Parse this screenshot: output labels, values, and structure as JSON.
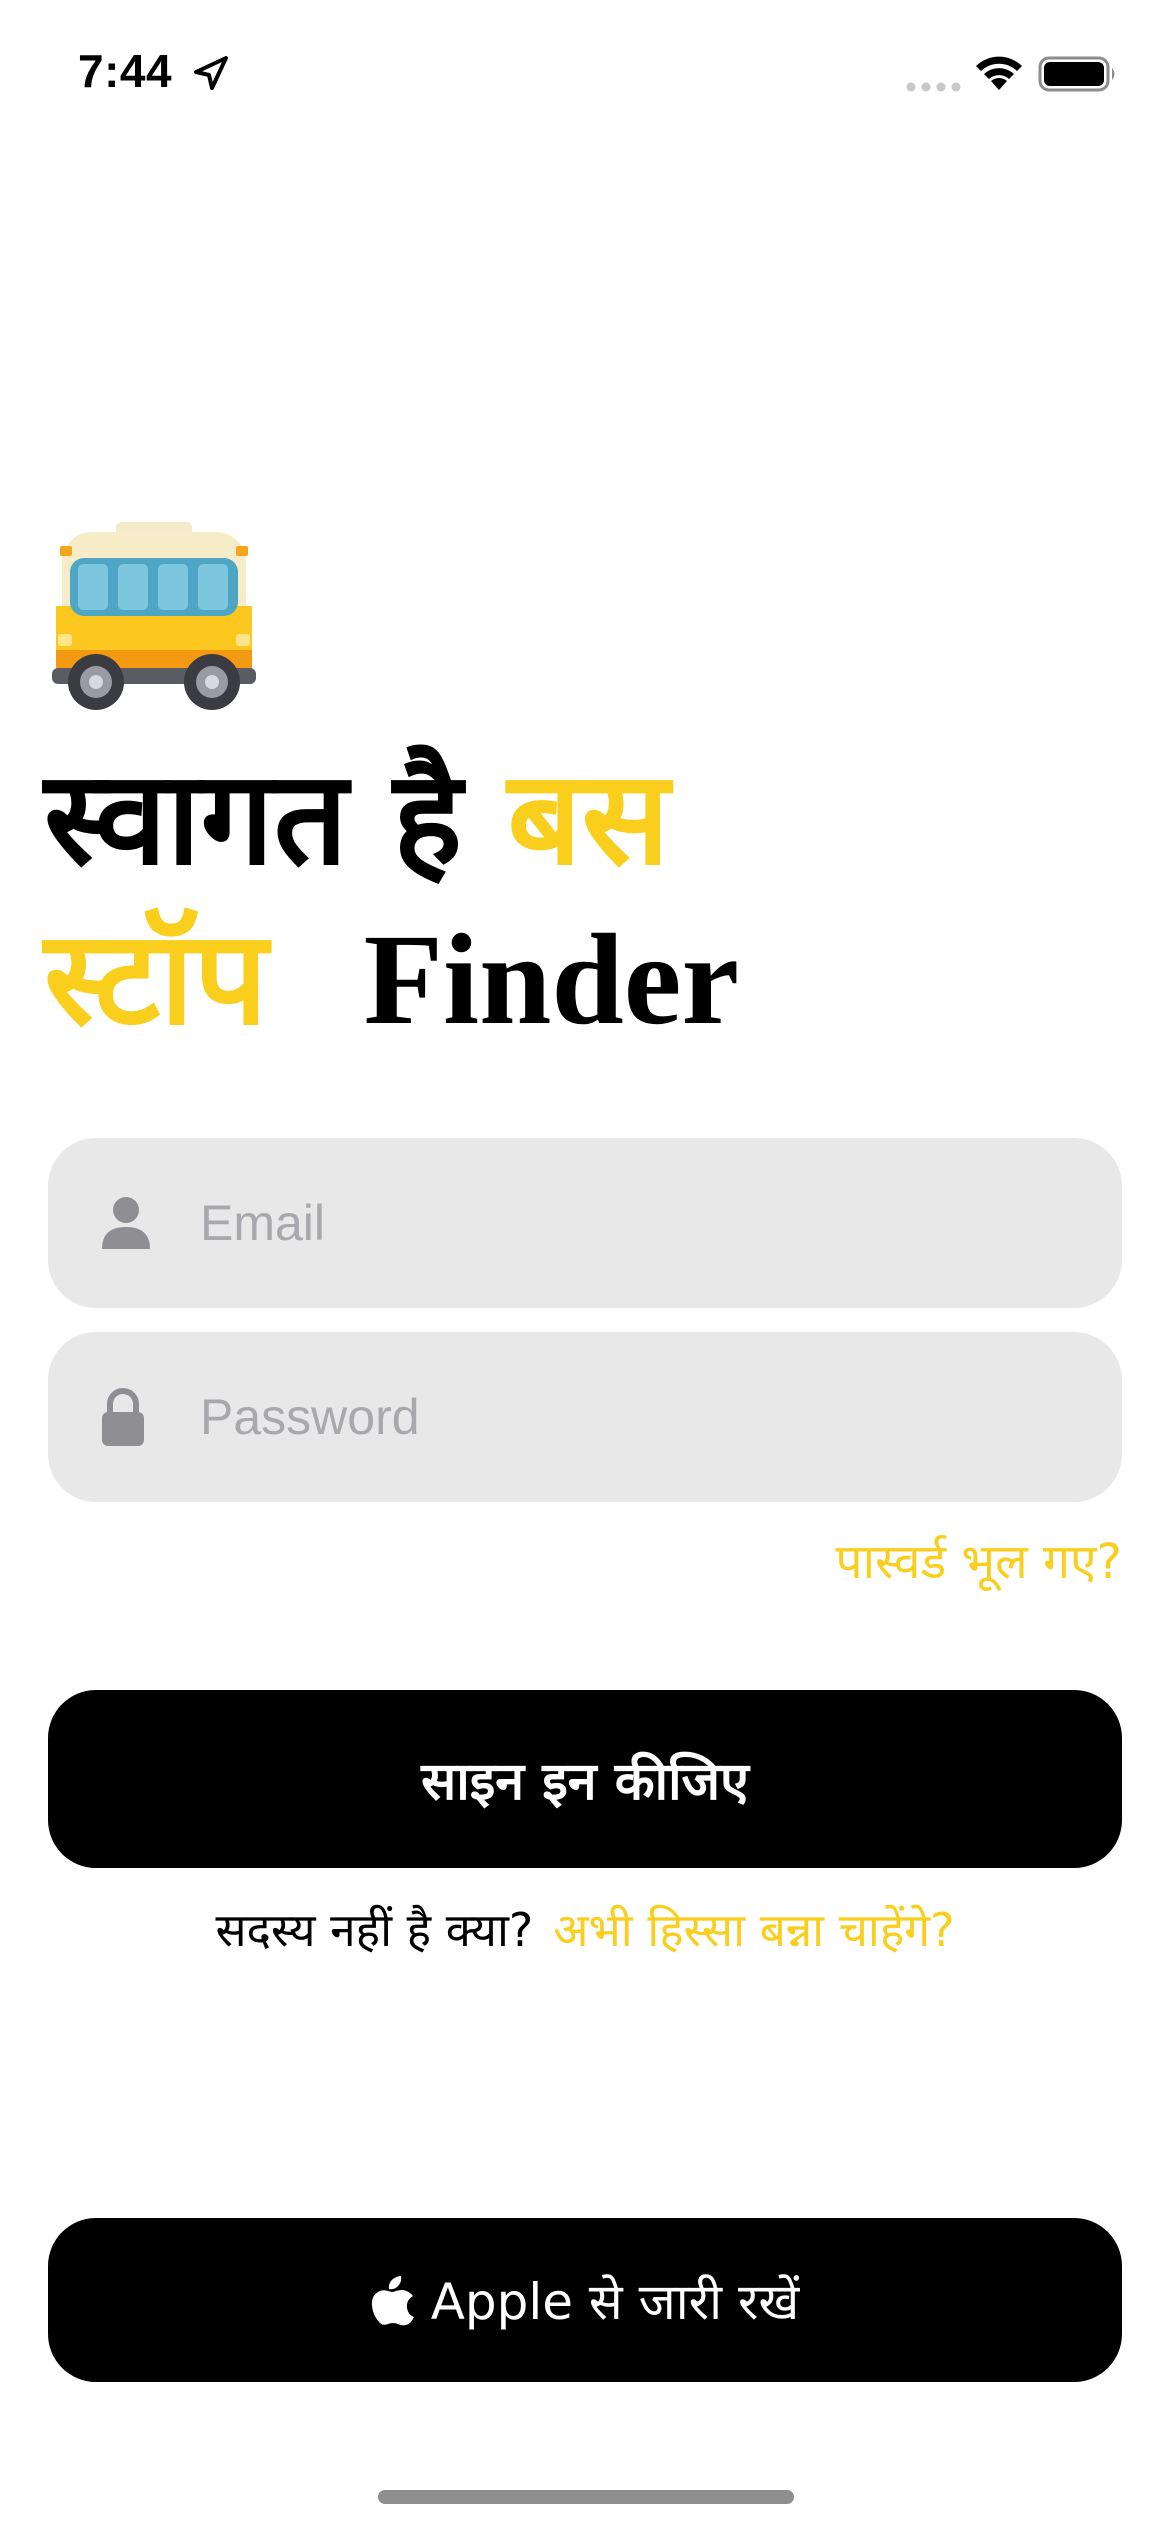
{
  "status_bar": {
    "time": "7:44"
  },
  "hero": {
    "icon": "bus-emoji",
    "title_part1": "स्वागत है",
    "title_accent": "बस स्टॉप",
    "title_accent_line1": "बस",
    "title_accent_line2": "स्टॉप",
    "title_app": "Finder"
  },
  "form": {
    "email": {
      "placeholder": "Email",
      "value": "",
      "icon": "person-icon"
    },
    "password": {
      "placeholder": "Password",
      "value": "",
      "icon": "lock-icon"
    },
    "forgot_password": "पास्वर्ड भूल गए?"
  },
  "actions": {
    "signin_label": "साइन इन कीजिए",
    "signup_question": "सदस्य नहीं है क्या?",
    "signup_link": "अभी हिस्सा बन्ना चाहेंगे?",
    "apple_label": "Apple से जारी रखें"
  },
  "colors": {
    "accent": "#f9ce1d",
    "field_bg": "#e8e8e8",
    "button_bg": "#000000",
    "placeholder": "#a9a9ad"
  }
}
